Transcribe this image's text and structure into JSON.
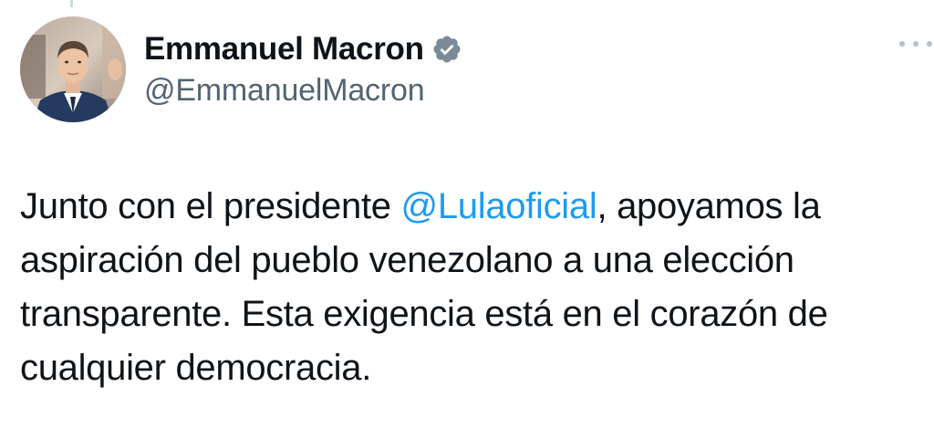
{
  "tweet": {
    "author": {
      "display_name": "Emmanuel Macron",
      "handle": "@EmmanuelMacron",
      "verified": true,
      "avatar_icon": "avatar-photo"
    },
    "text_lines": [
      {
        "before": "Junto con el presidente ",
        "mention": "@Lulaoficial",
        "after": ", apoyamos la"
      },
      {
        "text": "aspiración del pueblo venezolano a una elección"
      },
      {
        "text": "transparente. Esta exigencia está en el corazón de"
      },
      {
        "text": "cualquier democracia."
      }
    ],
    "more_icon": "more-horizontal-icon"
  },
  "colors": {
    "text": "#0f1419",
    "secondary": "#536471",
    "mention": "#1d9bf0",
    "verified_badge": "#7b8a96"
  }
}
